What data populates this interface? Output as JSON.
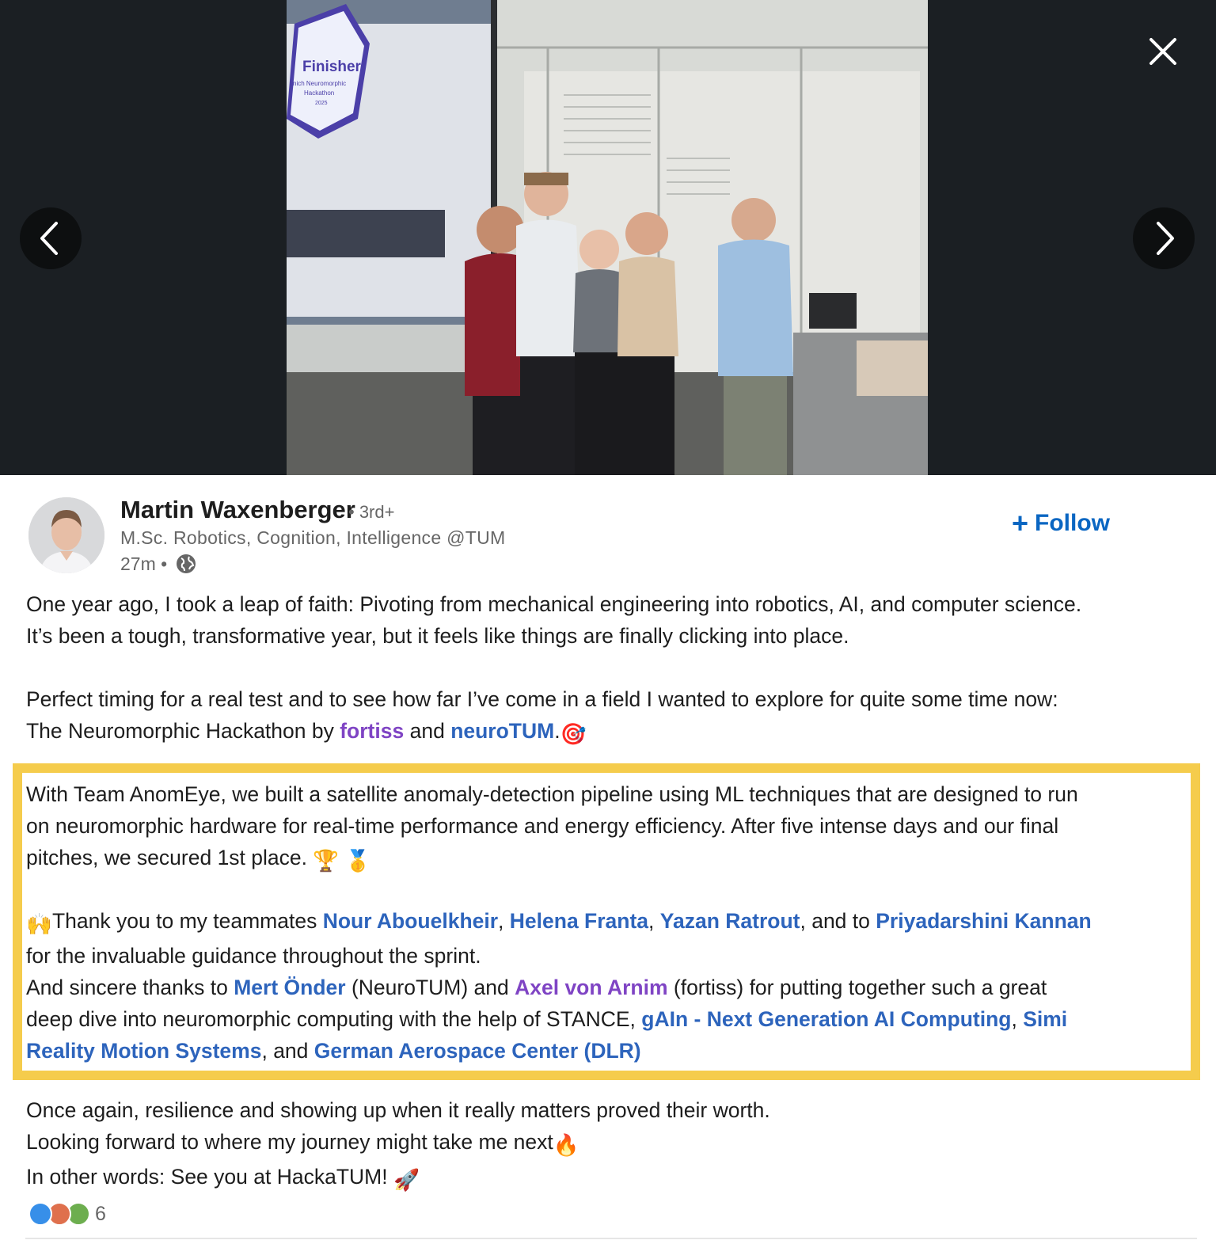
{
  "viewer": {
    "photo_text": {
      "badge_title": "Finisher",
      "badge_line1": "nich Neuromorphic",
      "badge_line2": "Hackathon",
      "badge_line3": "2025"
    }
  },
  "author": {
    "name": "Martin Waxenberger",
    "degree": "• 3rd+",
    "headline": "M.Sc. Robotics, Cognition, Intelligence @TUM",
    "time": "27m •",
    "follow_label": "Follow",
    "follow_plus": "+"
  },
  "post": {
    "p1_line1": "One year ago, I took a leap of faith: Pivoting from mechanical engineering into robotics, AI, and computer science.",
    "p1_line2": "It’s been a tough, transformative year, but it feels like things are finally clicking into place.",
    "p2_line1": "Perfect timing for a real test and to see how far I’ve come in a field I wanted to explore for quite some time now:",
    "p2_line2_a": "The Neuromorphic Hackathon by ",
    "p2_link_fortiss": "fortiss",
    "p2_line2_and": " and ",
    "p2_link_neurotum": "neuroTUM",
    "p2_line2_end": ".",
    "emoji_target": "🎯",
    "p3_line1": "With Team AnomEye, we built a satellite anomaly-detection pipeline using ML techniques that are designed to run",
    "p3_line2": "on neuromorphic hardware for real-time performance and energy efficiency. After five intense days and our final",
    "p3_line3": "pitches, we secured 1st place. ",
    "emoji_trophy": "🏆",
    "emoji_medal": "🥇",
    "emoji_raised_hands": "🙌",
    "p4_thanks": "Thank you to my teammates ",
    "mention_nour": "Nour Abouelkheir",
    "comma": ", ",
    "mention_helena": "Helena Franta",
    "mention_yazan": "Yazan Ratrout",
    "and_to": ", and to ",
    "mention_priya": "Priyadarshini Kannan",
    "p4_line2": " for the invaluable guidance throughout the sprint.",
    "p4_line3_a": "And sincere thanks to ",
    "mention_mert": "Mert Önder",
    "p4_line3_b": " (NeuroTUM) and ",
    "mention_axel": "Axel von Arnim",
    "p4_line3_c": " (fortiss) for putting together such a great",
    "p4_line4_a": "deep dive into neuromorphic computing with the help of STANCE, ",
    "mention_gain": "gAIn - Next Generation AI Computing",
    "mention_simi_1": "Simi",
    "mention_simi_2": "Reality Motion Systems",
    "p4_line5_and": ", and ",
    "mention_dlr": "German Aerospace Center (DLR)",
    "p5_line1": "Once again, resilience and showing up when it really matters proved their worth.",
    "p5_line2": "Looking forward to where my journey might take me next",
    "emoji_fire": "🔥",
    "p5_line3": "In other words: See you at HackaTUM! ",
    "emoji_rocket": "🚀"
  },
  "reactions": {
    "count": "6",
    "types": [
      "like",
      "love",
      "celebrate"
    ],
    "colors": {
      "like": "#378fe9",
      "love": "#df704d",
      "celebrate": "#6dae4f"
    }
  },
  "colors": {
    "link": "#2d64bc",
    "visited_link": "#7f44c4",
    "highlight_border": "#f5cc4c",
    "viewer_bg": "#1b1f23"
  }
}
